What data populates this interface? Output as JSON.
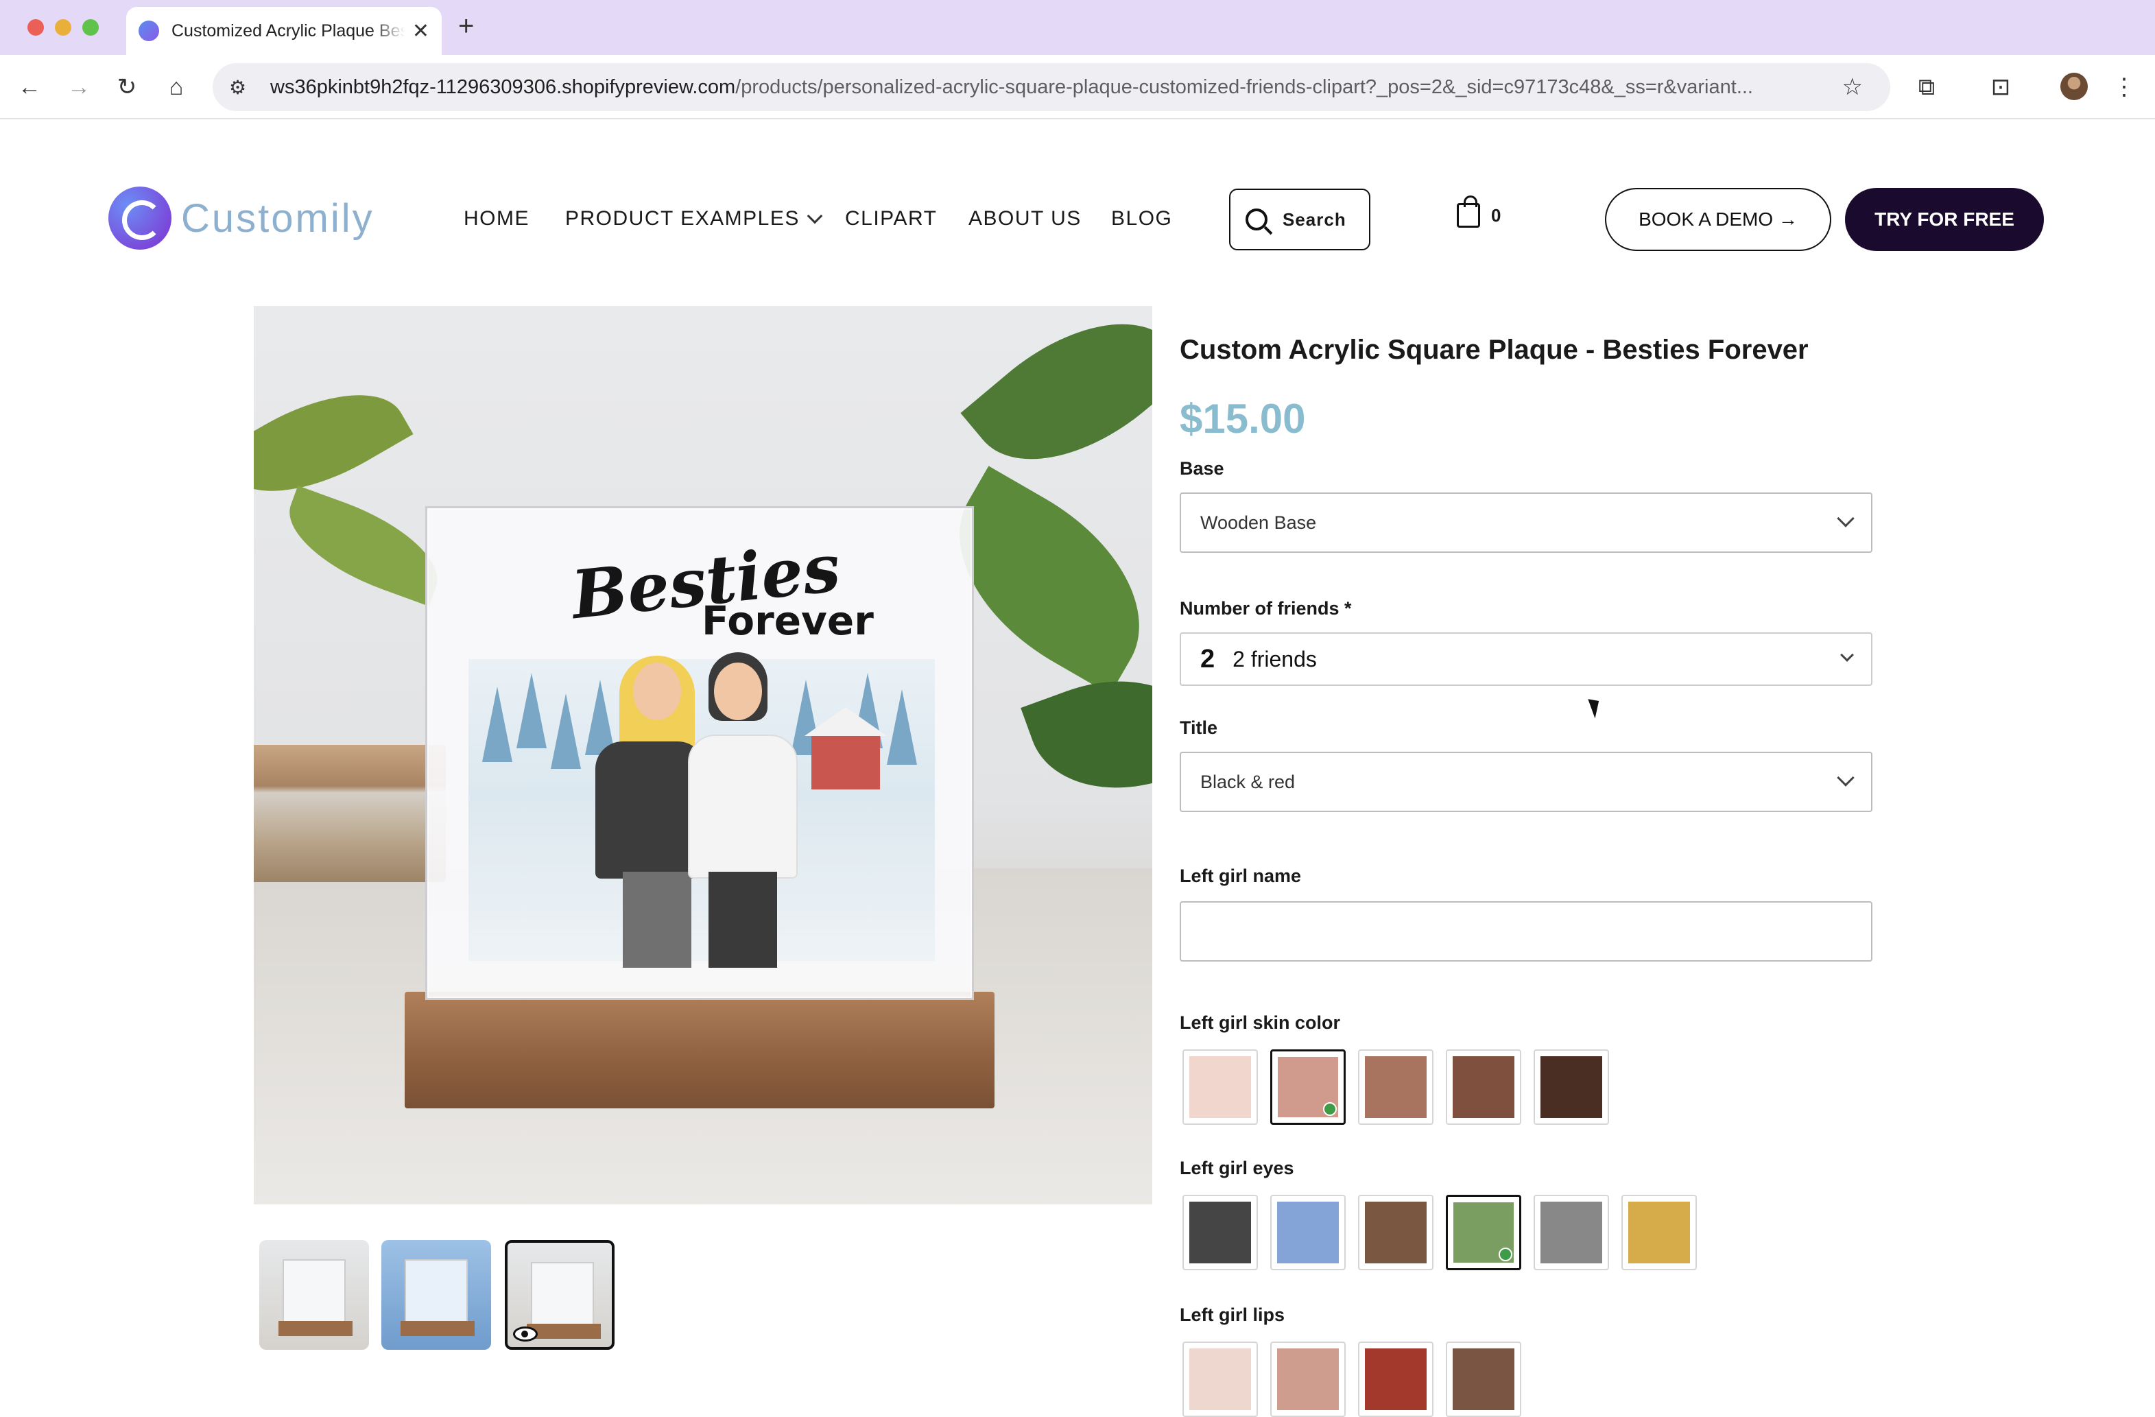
{
  "browser": {
    "tab_title": "Customized Acrylic Plaque Besties",
    "url_host": "ws36pkinbt9h2fqz-11296309306.shopifypreview.com",
    "url_path": "/products/personalized-acrylic-square-plaque-customized-friends-clipart?_pos=2&_sid=c97173c48&_ss=r&variant...",
    "icons": [
      "back-icon",
      "forward-icon",
      "reload-icon",
      "home-icon",
      "site-info-icon",
      "bookmark-star-icon",
      "extensions-icon",
      "tab-search-icon",
      "profile-avatar",
      "more-menu-icon"
    ]
  },
  "header": {
    "logo_text": "Customily",
    "nav": [
      "HOME",
      "PRODUCT EXAMPLES",
      "CLIPART",
      "ABOUT US",
      "BLOG"
    ],
    "search_label": "Search",
    "cart_count": "0",
    "book_demo": "BOOK A DEMO →",
    "try_free": "TRY FOR FREE"
  },
  "product": {
    "title": "Custom Acrylic Square Plaque - Besties Forever",
    "price": "$15.00",
    "image_text_1": "Besties",
    "image_text_2": "Forever",
    "thumbnails_count": 3,
    "active_thumbnail": 3
  },
  "options": {
    "base": {
      "label": "Base",
      "value": "Wooden Base"
    },
    "friends": {
      "label": "Number of friends *",
      "number": "2",
      "value": "2 friends"
    },
    "title_opt": {
      "label": "Title",
      "value": "Black & red"
    },
    "left_name": {
      "label": "Left girl name",
      "value": ""
    },
    "skin": {
      "label": "Left girl skin color",
      "colors": [
        "#f0d6cd",
        "#d09a8c",
        "#a87460",
        "#80503e",
        "#4a2e24"
      ],
      "selected": 1
    },
    "eyes": {
      "label": "Left girl eyes",
      "colors": [
        "#454545",
        "#84a4d8",
        "#7a5740",
        "#7a9e62",
        "#888888",
        "#d6ab4a"
      ],
      "selected": 3
    },
    "lips": {
      "label": "Left girl lips",
      "colors": [
        "#eed7ce",
        "#cf9d8e",
        "#a2392c",
        "#7a5544"
      ]
    }
  },
  "colors": {
    "accent_price": "#89bccf",
    "button_dark": "#1a0b2e",
    "tab_bar": "#e4d9f6"
  }
}
